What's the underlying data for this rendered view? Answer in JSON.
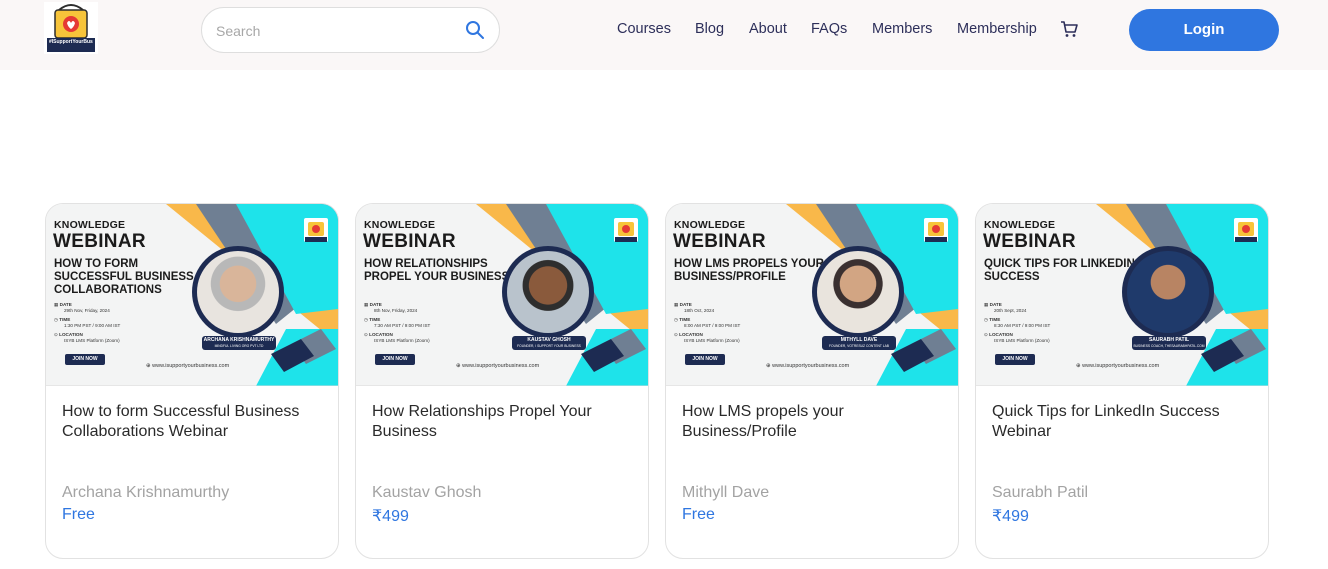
{
  "header": {
    "logo_text": "#ISupportYourBusiness",
    "search": {
      "placeholder": "Search",
      "value": ""
    },
    "nav": [
      {
        "label": "Courses"
      },
      {
        "label": "Blog"
      },
      {
        "label": "About"
      },
      {
        "label": "FAQs"
      },
      {
        "label": "Members"
      },
      {
        "label": "Membership"
      }
    ],
    "cart_icon": "cart-icon",
    "login_label": "Login"
  },
  "colors": {
    "accent": "#2f76e0",
    "nav_text": "#2d2f5a",
    "banner_cyan": "#1ee3ea",
    "banner_orange": "#f9b84a",
    "banner_grey": "#6f7f93",
    "banner_navy": "#1d2b52"
  },
  "courses": [
    {
      "banner": {
        "kicker": "KNOWLEDGE",
        "heading": "WEBINAR",
        "topic": "HOW TO FORM SUCCESSFUL BUSINESS COLLABORATIONS",
        "date_label": "DATE",
        "date": "29th Nov, Friday, 2024",
        "time_label": "TIME",
        "time": "1:30 PM PST / 9:00 AM IST",
        "location_label": "LOCATION",
        "location": "ISYB LMS Platform (Zoom)",
        "cta": "JOIN NOW",
        "url": "www.isupportyourbusiness.com",
        "speaker": "ARCHANA KRISHNAMURTHY",
        "speaker_org": "MINDFUL LIVING ORG PVT LTD"
      },
      "title": "How to form Successful Business Collaborations Webinar",
      "author": "Archana Krishnamurthy",
      "price": "Free"
    },
    {
      "banner": {
        "kicker": "KNOWLEDGE",
        "heading": "WEBINAR",
        "topic": "HOW RELATIONSHIPS PROPEL YOUR BUSINESS",
        "date_label": "DATE",
        "date": "8th Nov, Friday, 2024",
        "time_label": "TIME",
        "time": "7:30 AM PST / 9:00 PM IST",
        "location_label": "LOCATION",
        "location": "ISYB LMS Platform (Zoom)",
        "cta": "JOIN NOW",
        "url": "www.isupportyourbusiness.com",
        "speaker": "KAUSTAV GHOSH",
        "speaker_org": "FOUNDER, I SUPPORT YOUR BUSINESS"
      },
      "title": "How Relationships Propel Your Business",
      "author": "Kaustav Ghosh",
      "price": "₹499"
    },
    {
      "banner": {
        "kicker": "KNOWLEDGE",
        "heading": "WEBINAR",
        "topic": "HOW LMS PROPELS YOUR BUSINESS/PROFILE",
        "date_label": "DATE",
        "date": "18th Oct, 2024",
        "time_label": "TIME",
        "time": "8:00 AM PST / 9:00 PM IST",
        "location_label": "LOCATION",
        "location": "ISYB LMS Platform (Zoom)",
        "cta": "JOIN NOW",
        "url": "www.isupportyourbusiness.com",
        "speaker": "MITHYLL DAVE",
        "speaker_org": "FOUNDER, VOTRESUZ CONTENT LAB"
      },
      "title": "How LMS propels your Business/Profile",
      "author": "Mithyll Dave",
      "price": "Free"
    },
    {
      "banner": {
        "kicker": "KNOWLEDGE",
        "heading": "WEBINAR",
        "topic": "QUICK TIPS FOR LINKEDIN SUCCESS",
        "date_label": "DATE",
        "date": "20th Sept, 2024",
        "time_label": "TIME",
        "time": "8:30 AM PST / 9:00 PM IST",
        "location_label": "LOCATION",
        "location": "ISYB LMS Platform (Zoom)",
        "cta": "JOIN NOW",
        "url": "www.isupportyourbusiness.com",
        "speaker": "SAURABH PATIL",
        "speaker_org": "BUSINESS COACH, THESAURABHPATIL.COM"
      },
      "title": "Quick Tips for LinkedIn Success Webinar",
      "author": "Saurabh Patil",
      "price": "₹499"
    }
  ]
}
